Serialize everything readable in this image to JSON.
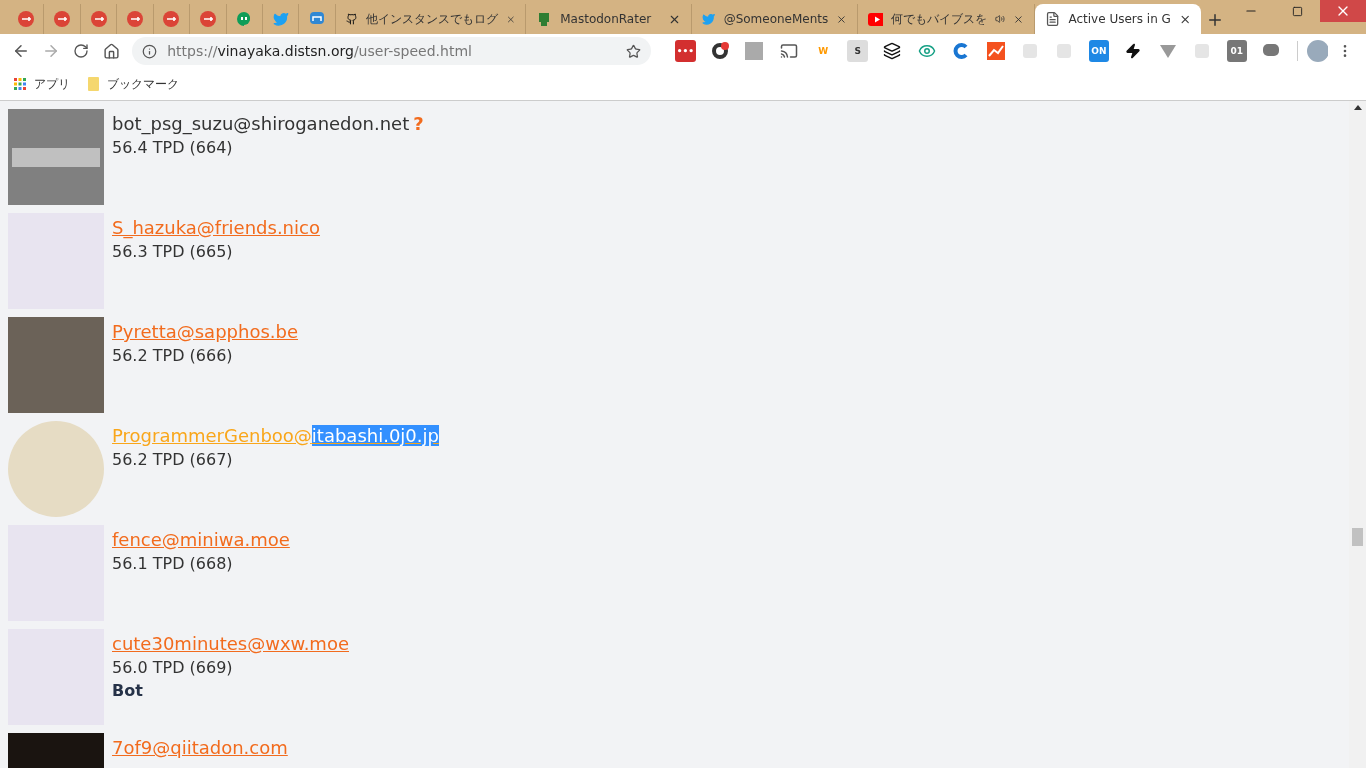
{
  "tabs": [
    {
      "kind": "gplus",
      "selected": false
    },
    {
      "kind": "gplus",
      "selected": false
    },
    {
      "kind": "gplus",
      "selected": false
    },
    {
      "kind": "gplus",
      "selected": false
    },
    {
      "kind": "gplus",
      "selected": false
    },
    {
      "kind": "gplus",
      "selected": false
    },
    {
      "kind": "chat",
      "selected": false
    },
    {
      "kind": "bird",
      "selected": false
    },
    {
      "kind": "mastodon",
      "selected": false
    },
    {
      "kind": "github",
      "title": "他インスタンスでもログ",
      "selected": false,
      "audio": false
    },
    {
      "kind": "robot",
      "title": "MastodonRater",
      "selected": false,
      "audio": false
    },
    {
      "kind": "bird",
      "title": "@SomeoneMents",
      "selected": false,
      "audio": false
    },
    {
      "kind": "video",
      "title": "何でもバイブスを",
      "selected": false,
      "audio": true
    },
    {
      "kind": "page",
      "title": "Active Users in G",
      "selected": true,
      "audio": false
    }
  ],
  "address": {
    "host": "vinayaka.distsn.org",
    "path": "/user-speed.html",
    "prefix": "https://"
  },
  "extensions": [
    {
      "kind": "red",
      "glyph": "•••"
    },
    {
      "kind": "ring"
    },
    {
      "kind": "gray"
    },
    {
      "kind": "cast"
    },
    {
      "kind": "letter",
      "glyph": "W"
    },
    {
      "kind": "letter-s",
      "glyph": "S"
    },
    {
      "kind": "stack"
    },
    {
      "kind": "eye"
    },
    {
      "kind": "c"
    },
    {
      "kind": "chart"
    },
    {
      "kind": "faint"
    },
    {
      "kind": "faint"
    },
    {
      "kind": "on",
      "glyph": "ON"
    },
    {
      "kind": "bolt"
    },
    {
      "kind": "v"
    },
    {
      "kind": "faint"
    },
    {
      "kind": "dark",
      "glyph": "01"
    },
    {
      "kind": "bubble"
    }
  ],
  "bookmarks": [
    {
      "kind": "apps",
      "label": "アプリ"
    },
    {
      "kind": "folder",
      "label": "ブックマーク"
    }
  ],
  "users": [
    {
      "avatar": {
        "kind": "placeholder"
      },
      "name": "bot_psg_suzu@shiroganedon.net",
      "link": false,
      "mark": "?",
      "speed": "56.4 TPD (664)"
    },
    {
      "avatar": {
        "kind": "drawing"
      },
      "name": "S_hazuka@friends.nico",
      "link": true,
      "speed": "56.3 TPD (665)"
    },
    {
      "avatar": {
        "kind": "photo"
      },
      "name": "Pyretta@sapphos.be",
      "link": true,
      "speed": "56.2 TPD (666)"
    },
    {
      "avatar": {
        "kind": "round"
      },
      "name": "ProgrammerGenboo@",
      "selected_text": "itabashi.0j0.jp",
      "link": true,
      "speed": "56.2 TPD (667)"
    },
    {
      "avatar": {
        "kind": "drawing"
      },
      "name": "fence@miniwa.moe",
      "link": true,
      "speed": "56.1 TPD (668)"
    },
    {
      "avatar": {
        "kind": "drawing"
      },
      "name": "cute30minutes@wxw.moe",
      "link": true,
      "speed": "56.0 TPD (669)",
      "tag": "Bot"
    },
    {
      "avatar": {
        "kind": "dark"
      },
      "name": "7of9@qiitadon.com",
      "link": true
    }
  ]
}
